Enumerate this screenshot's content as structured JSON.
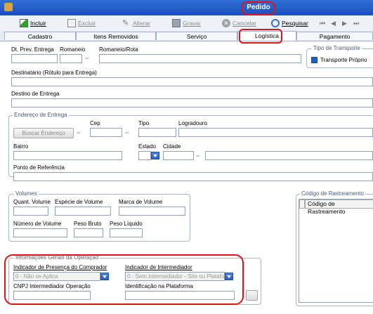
{
  "window": {
    "title": "Pedido"
  },
  "toolbar": {
    "incluir": "Incluir",
    "excluir": "Excluir",
    "alterar": "Alterar",
    "gravar": "Gravar",
    "cancelar": "Cancelar",
    "pesquisar": "Pesquisar"
  },
  "tabs": [
    "Cadastro",
    "Itens Removidos",
    "Serviço",
    "Logística",
    "Pagamento"
  ],
  "logistica": {
    "dt_prev_entrega_label": "Dt. Prev. Entrega",
    "romaneio_label": "Romaneio",
    "romaneio_rota_label": "Romaneio/Rota",
    "tipo_transporte_legend": "Tipo de Transporte",
    "transporte_proprio_label": "Transporte Próprio",
    "destinatario_label": "Destinatário (Rótulo para Entrega)",
    "destino_entrega_label": "Destino de Entrega",
    "endereco_legend": "Endereço de Entrega",
    "cep_label": "Cep",
    "tipo_label": "Tipo",
    "logradouro_label": "Logradouro",
    "buscar_endereco_label": "Buscar Endereço",
    "bairro_label": "Bairro",
    "estado_label": "Estado",
    "cidade_label": "Cidade",
    "ponto_referencia_label": "Ponto de Referência",
    "volumes_legend": "Volumes",
    "quant_volume_label": "Quant. Volume",
    "especie_volume_label": "Espécie de Volume",
    "marca_volume_label": "Marca de Volume",
    "numero_volume_label": "Número de Volume",
    "peso_bruto_label": "Peso Bruto",
    "peso_liquido_label": "Peso Líquido",
    "rastreamento_legend": "Código de Rastreamento",
    "rastreamento_col": "Código de Rastreamento",
    "info_legend": "Informações Gerais da Operação",
    "indicador_presenca_label": "Indicador de Presença do Comprador",
    "indicador_presenca_value": "0 - Não se Aplica",
    "indicador_intermediador_label": "Indicador de Intermediador",
    "indicador_intermediador_value": "0 - Sem intermediador - Site ou Plataform",
    "cnpj_intermediador_label": "CNPJ Intermediador Operação",
    "identificacao_plataforma_label": "Identificação na Plataforma"
  },
  "colors": {
    "highlight": "#e0131b",
    "titlebar": "#2f6fd8"
  },
  "icons": [
    "app-icon",
    "incluir-icon",
    "excluir-icon",
    "alterar-icon",
    "gravar-icon",
    "cancelar-icon",
    "pesquisar-icon",
    "nav-first-icon",
    "nav-prev-icon",
    "nav-next-icon",
    "nav-last-icon",
    "lookup-icon",
    "chevron-down-icon"
  ]
}
